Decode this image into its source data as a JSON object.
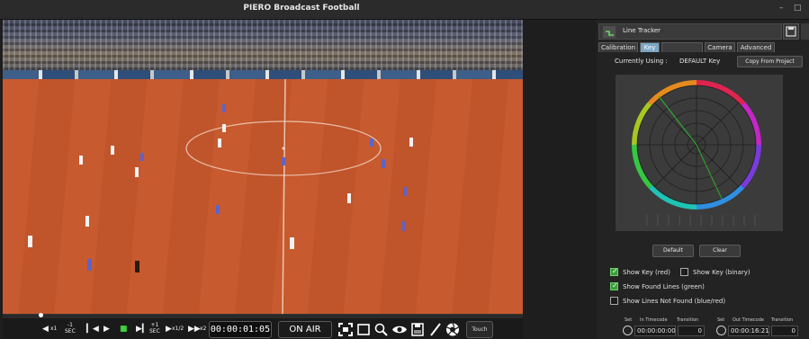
{
  "window": {
    "title": "PIERO Broadcast Football",
    "minimize_glyph": "–",
    "maximize_glyph": "□"
  },
  "playback": {
    "step_back_label": "-1\nSEC",
    "rewind_label": "x1",
    "step_fwd_label": "+1\nSEC",
    "slow_label": "x1/2",
    "fast_label": "x2",
    "timecode": "00:00:01:05",
    "on_air_label": "ON AIR",
    "touch_label": "Touch",
    "progress": 0.07
  },
  "panel": {
    "tracker_label": "Line Tracker",
    "tabs": [
      "Calibration",
      "Key",
      "",
      "Camera",
      "Advanced"
    ],
    "active_tab": "Key",
    "currently_using_label": "Currently Using :",
    "currently_using_value": "DEFAULT Key",
    "copy_from_project_label": "Copy From Project",
    "default_label": "Default",
    "clear_label": "Clear",
    "checks": {
      "show_key_red": {
        "label": "Show Key (red)",
        "checked": true
      },
      "show_key_binary": {
        "label": "Show Key (binary)",
        "checked": false
      },
      "show_found_lines": {
        "label": "Show Found Lines (green)",
        "checked": true
      },
      "show_lines_not_found": {
        "label": "Show Lines Not Found (blue/red)",
        "checked": false
      }
    },
    "timecode_in": {
      "set_label": "Set",
      "timecode_label": "In Timecode",
      "transition_label": "Transition",
      "timecode": "00:00:00:00",
      "transition": "0"
    },
    "timecode_out": {
      "set_label": "Set",
      "timecode_label": "Out Timecode",
      "transition_label": "Transition",
      "timecode": "00:00:16:21",
      "transition": "0"
    }
  },
  "icons": {
    "fullscreen": "fullscreen-icon",
    "rect": "rectangle-icon",
    "zoom": "magnifier-icon",
    "eye": "eye-icon",
    "save": "floppy-icon",
    "draw": "pen-icon",
    "settings": "aperture-icon",
    "tracker": "line-tracker-icon",
    "clock": "clock-icon"
  },
  "colors": {
    "key_overlay": "#c55a2f",
    "active_tab": "#7aa6c4",
    "check_on": "#3a9d3a"
  }
}
